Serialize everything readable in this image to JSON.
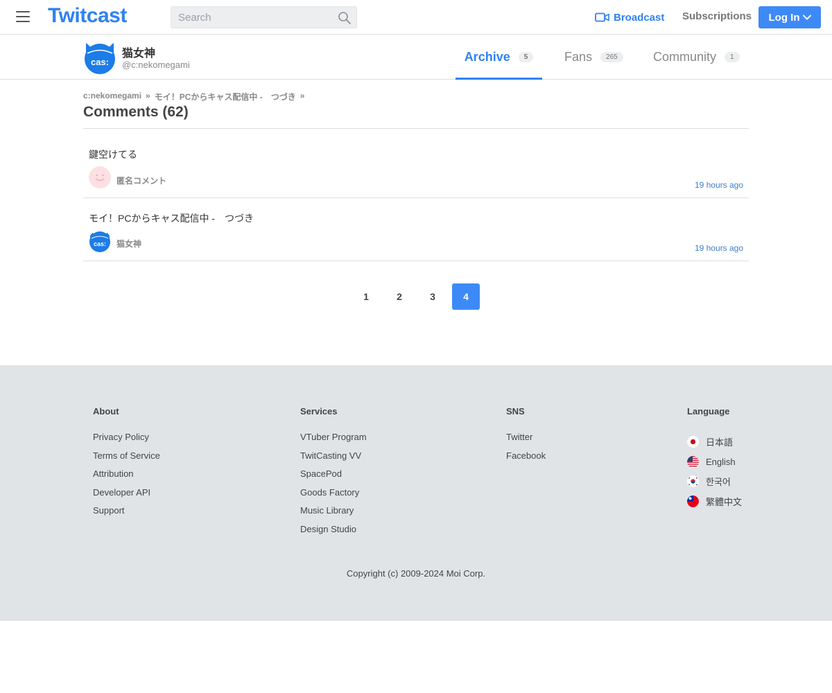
{
  "header": {
    "logo": "Twitcast",
    "search_placeholder": "Search",
    "broadcast_label": "Broadcast",
    "subscriptions_label": "Subscriptions",
    "login_label": "Log In"
  },
  "profile": {
    "name": "猫女神",
    "handle": "@c:nekomegami",
    "avatar_text": "cas:",
    "tabs": [
      {
        "label": "Archive",
        "count": "5",
        "active": true
      },
      {
        "label": "Fans",
        "count": "265",
        "active": false
      },
      {
        "label": "Community",
        "count": "1",
        "active": false
      }
    ]
  },
  "breadcrumb": {
    "items": [
      "c:nekomegami",
      "モイ！PCからキャス配信中 -　つづき"
    ],
    "separator": "»"
  },
  "page_title": "Comments (62)",
  "comments": [
    {
      "text": "鍵空けてる",
      "author": "匿名コメント",
      "time": "19 hours ago",
      "avatar": "anonymous-smile"
    },
    {
      "text": "モイ！PCからキャス配信中 -　つづき",
      "author": "猫女神",
      "time": "19 hours ago",
      "avatar": "cas"
    }
  ],
  "pagination": {
    "pages": [
      "1",
      "2",
      "3",
      "4"
    ],
    "current": "4"
  },
  "footer": {
    "about": {
      "title": "About",
      "links": [
        "Privacy Policy",
        "Terms of Service",
        "Attribution",
        "Developer API",
        "Support"
      ]
    },
    "services": {
      "title": "Services",
      "links": [
        "VTuber Program",
        "TwitCasting VV",
        "SpacePod",
        "Goods Factory",
        "Music Library",
        "Design Studio"
      ]
    },
    "sns": {
      "title": "SNS",
      "links": [
        "Twitter",
        "Facebook"
      ]
    },
    "language": {
      "title": "Language",
      "links": [
        "日本語",
        "English",
        "한국어",
        "繁體中文"
      ]
    },
    "copyright": "Copyright (c) 2009-2024 Moi Corp."
  },
  "colors": {
    "accent": "#2f82f2",
    "button": "#3d8af7",
    "footer_bg": "#e1e4e7",
    "link_time": "#3d82c9"
  }
}
